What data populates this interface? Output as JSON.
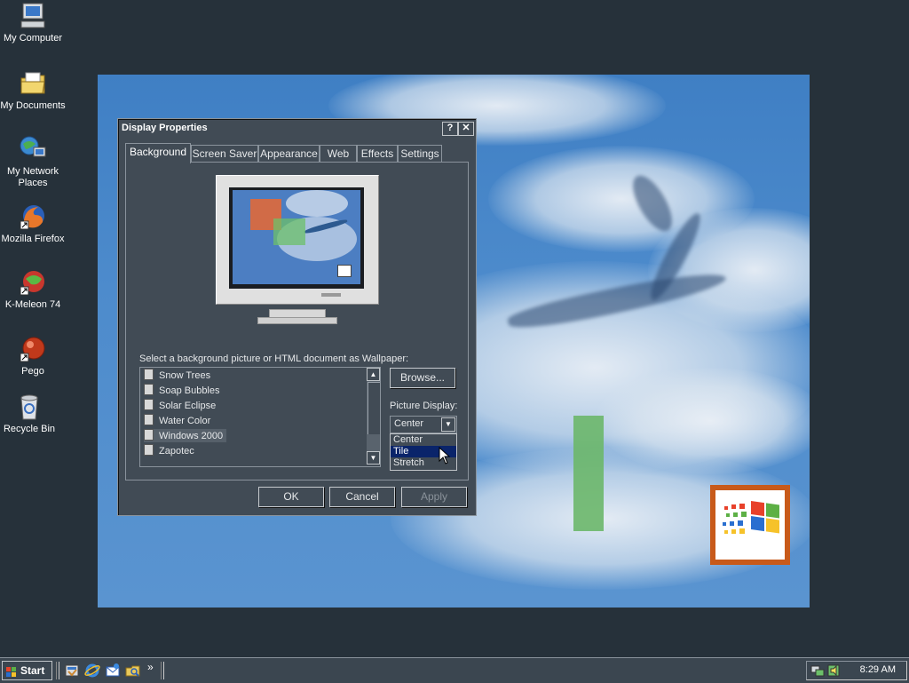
{
  "desktop": {
    "icons": [
      {
        "label": "My Computer",
        "icon": "computer-icon"
      },
      {
        "label": "My Documents",
        "icon": "folder-icon"
      },
      {
        "label": "My Network Places",
        "icon": "network-icon"
      },
      {
        "label": "Mozilla Firefox",
        "icon": "firefox-icon"
      },
      {
        "label": "K-Meleon 74",
        "icon": "kmeleon-icon"
      },
      {
        "label": "Pego",
        "icon": "pego-icon"
      },
      {
        "label": "Recycle Bin",
        "icon": "recycle-bin-icon"
      }
    ]
  },
  "dialog": {
    "title": "Display Properties",
    "help_glyph": "?",
    "close_glyph": "✕",
    "tabs": [
      "Background",
      "Screen Saver",
      "Appearance",
      "Web",
      "Effects",
      "Settings"
    ],
    "active_tab": "Background",
    "wallpaper_label": "Select a background picture or HTML document as Wallpaper:",
    "wallpapers": [
      {
        "name": "Snow Trees"
      },
      {
        "name": "Soap Bubbles"
      },
      {
        "name": "Solar Eclipse"
      },
      {
        "name": "Water Color"
      },
      {
        "name": "Windows 2000",
        "selected": true
      },
      {
        "name": "Zapotec"
      }
    ],
    "browse_label": "Browse...",
    "picture_display_label": "Picture Display:",
    "picture_display_value": "Center",
    "picture_display_options": [
      "Center",
      "Tile",
      "Stretch"
    ],
    "picture_display_highlighted": "Tile",
    "ok_label": "OK",
    "cancel_label": "Cancel",
    "apply_label": "Apply"
  },
  "taskbar": {
    "start_label": "Start",
    "chevron": "»",
    "quicklaunch": [
      "show-desktop-icon",
      "ie-icon",
      "outlook-icon",
      "explorer-icon"
    ],
    "clock": "8:29 AM"
  },
  "colors": {
    "desktop_bg": "#26313a",
    "dialog_bg": "#414b55",
    "selection": "#0a246a",
    "wallpaper_blue": "#4d8bcc"
  }
}
